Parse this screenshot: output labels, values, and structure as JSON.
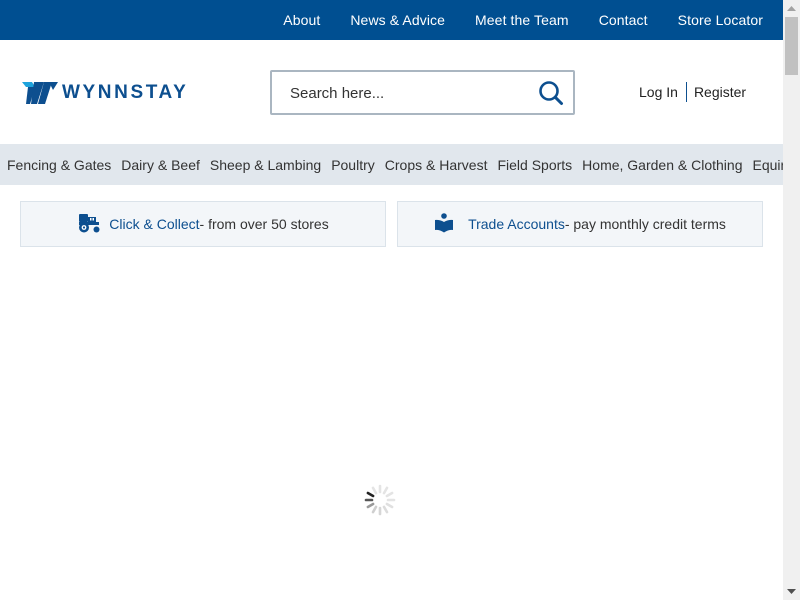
{
  "topbar": {
    "links": [
      {
        "label": "About"
      },
      {
        "label": "News & Advice"
      },
      {
        "label": "Meet the Team"
      },
      {
        "label": "Contact"
      },
      {
        "label": "Store Locator"
      }
    ]
  },
  "header": {
    "logo_text": "WYNNSTAY",
    "search": {
      "placeholder": "Search here...",
      "value": "",
      "icon": "search-icon"
    },
    "account": {
      "login_label": "Log In",
      "register_label": "Register"
    }
  },
  "category_nav": {
    "items": [
      {
        "label": "Fencing & Gates"
      },
      {
        "label": "Dairy & Beef"
      },
      {
        "label": "Sheep & Lambing"
      },
      {
        "label": "Poultry"
      },
      {
        "label": "Crops & Harvest"
      },
      {
        "label": "Field Sports"
      },
      {
        "label": "Home, Garden & Clothing"
      },
      {
        "label": "Equine"
      }
    ]
  },
  "promos": [
    {
      "icon": "tractor-icon",
      "link": "Click & Collect",
      "desc": "- from over 50 stores"
    },
    {
      "icon": "reader-icon",
      "link": "Trade Accounts",
      "desc": "- pay monthly credit terms"
    }
  ],
  "main": {
    "loading": true,
    "spinner_icon": "loading-spinner-icon"
  },
  "colors": {
    "brand_blue": "#004f91",
    "link_blue": "#0d4f8f",
    "nav_bg": "#e1e7ed",
    "promo_bg": "#f3f6f9"
  }
}
